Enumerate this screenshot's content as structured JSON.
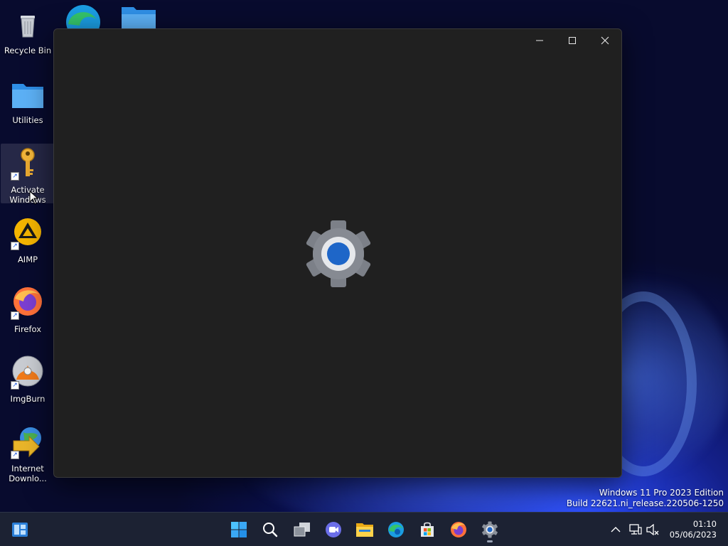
{
  "desktop": {
    "icons": [
      {
        "label": "Recycle Bin"
      },
      {
        "label": "Utilities"
      },
      {
        "label": "Activate Windows"
      },
      {
        "label": "AIMP"
      },
      {
        "label": "Firefox"
      },
      {
        "label": "ImgBurn"
      },
      {
        "label": "Internet Downlo..."
      }
    ]
  },
  "window": {
    "state": "loading",
    "icon": "settings-gear-icon",
    "controls": [
      "minimize",
      "maximize",
      "close"
    ]
  },
  "watermark": {
    "line1": "Windows 11 Pro 2023 Edition",
    "line2": "Build 22621.ni_release.220506-1250"
  },
  "taskbar": {
    "pinned": [
      "start",
      "search",
      "task-view",
      "chat",
      "file-explorer",
      "edge",
      "microsoft-store",
      "firefox",
      "settings"
    ],
    "active": "settings",
    "clock": {
      "time": "01:10",
      "date": "05/06/2023"
    }
  },
  "colors": {
    "accent": "#1e66c8",
    "window_bg": "#202020",
    "taskbar_bg": "#1c2233"
  }
}
